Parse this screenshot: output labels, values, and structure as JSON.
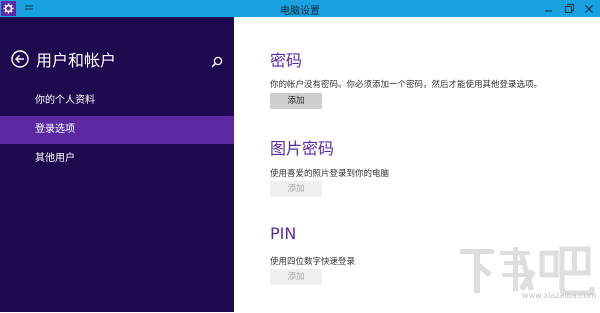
{
  "window": {
    "title": "电脑设置",
    "minimize_glyph": "—",
    "restore_glyph": "❐",
    "close_glyph": "✕"
  },
  "sidebar": {
    "title": "用户和帐户",
    "items": [
      {
        "label": "你的个人资料",
        "active": false
      },
      {
        "label": "登录选项",
        "active": true
      },
      {
        "label": "其他用户",
        "active": false
      }
    ]
  },
  "sections": {
    "password": {
      "title": "密码",
      "description": "你的帐户没有密码。你必须添加一个密码，然后才能使用其他登录选项。",
      "button_label": "添加",
      "button_enabled": true
    },
    "picture_password": {
      "title": "图片密码",
      "description": "使用喜爱的照片登录到你的电脑",
      "button_label": "添加",
      "button_enabled": false
    },
    "pin": {
      "title": "PIN",
      "description": "使用四位数字快速登录",
      "button_label": "添加",
      "button_enabled": false
    }
  },
  "watermark": {
    "brand": "下载吧",
    "url": "www.xiazaiba.com"
  },
  "colors": {
    "titlebar": "#1aa1e1",
    "sidebar_bg": "#1f0a50",
    "accent": "#5b2aa3"
  }
}
